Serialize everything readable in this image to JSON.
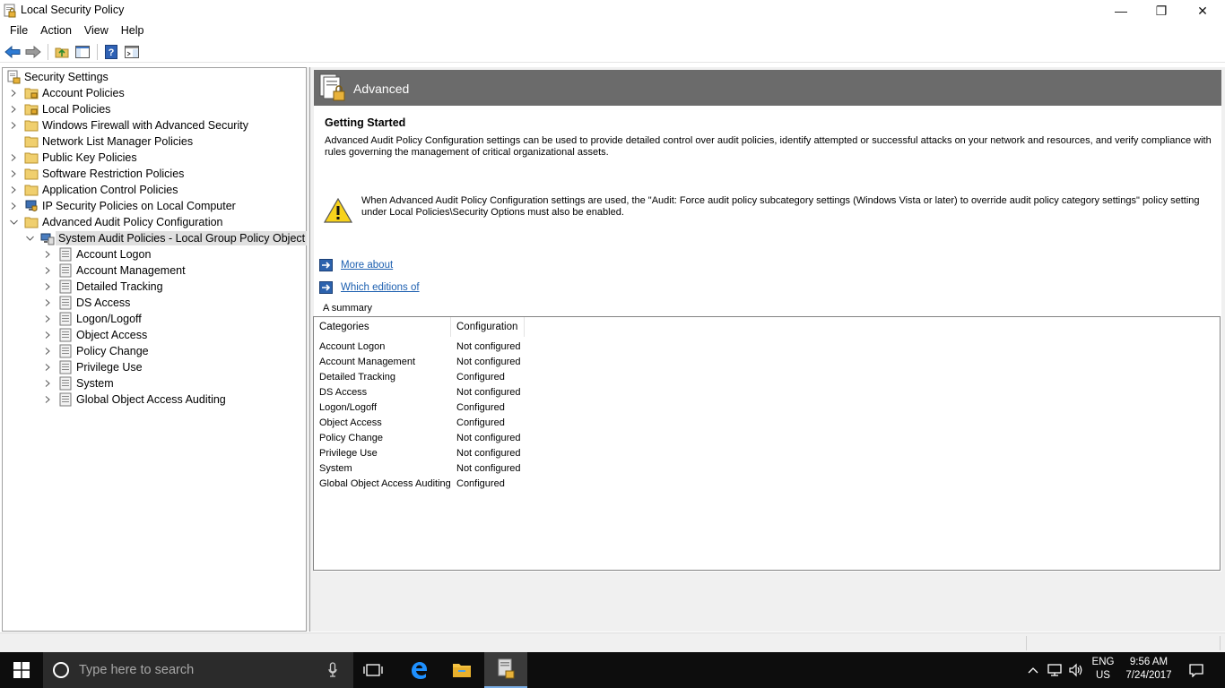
{
  "window": {
    "title": "Local Security Policy",
    "minimize_glyph": "—",
    "maximize_glyph": "❐",
    "close_glyph": "✕"
  },
  "menu": [
    "File",
    "Action",
    "View",
    "Help"
  ],
  "toolbar": [
    "back-arrow-icon",
    "forward-arrow-icon",
    "up-folder-icon",
    "show-hide-tree-icon",
    "help-icon",
    "properties-icon"
  ],
  "tree": {
    "root": "Security Settings",
    "items": [
      "Account Policies",
      "Local Policies",
      "Windows Firewall with Advanced Security",
      "Network List Manager Policies",
      "Public Key Policies",
      "Software Restriction Policies",
      "Application Control Policies",
      "IP Security Policies on Local Computer",
      "Advanced Audit Policy Configuration"
    ],
    "selected": "System Audit Policies - Local Group Policy Object",
    "children": [
      "Account Logon",
      "Account Management",
      "Detailed Tracking",
      "DS Access",
      "Logon/Logoff",
      "Object Access",
      "Policy Change",
      "Privilege Use",
      "System",
      "Global Object Access Auditing"
    ]
  },
  "content": {
    "banner_title": "Advanced",
    "getting_started": "Getting Started",
    "description": "Advanced Audit Policy Configuration settings can be used to provide detailed control over audit policies, identify attempted or successful attacks on your network and resources, and verify compliance with rules governing the management of critical organizational assets.",
    "warning": "When Advanced Audit Policy Configuration settings are used, the \"Audit: Force audit policy subcategory settings (Windows Vista or later) to override audit policy category settings\" policy setting under Local Policies\\Security Options must also be enabled.",
    "link_more": "More about",
    "link_editions": "Which editions of",
    "summary_label": "A summary"
  },
  "summary_table": {
    "headers": [
      "Categories",
      "Configuration"
    ],
    "rows": [
      [
        "Account Logon",
        "Not configured"
      ],
      [
        "Account Management",
        "Not configured"
      ],
      [
        "Detailed Tracking",
        "Configured"
      ],
      [
        "DS Access",
        "Not configured"
      ],
      [
        "Logon/Logoff",
        "Configured"
      ],
      [
        "Object Access",
        "Configured"
      ],
      [
        "Policy Change",
        "Not configured"
      ],
      [
        "Privilege Use",
        "Not configured"
      ],
      [
        "System",
        "Not configured"
      ],
      [
        "Global Object Access Auditing",
        "Configured"
      ]
    ]
  },
  "taskbar": {
    "search_placeholder": "Type here to search",
    "lang_top": "ENG",
    "lang_bottom": "US",
    "time": "9:56 AM",
    "date": "7/24/2017"
  }
}
